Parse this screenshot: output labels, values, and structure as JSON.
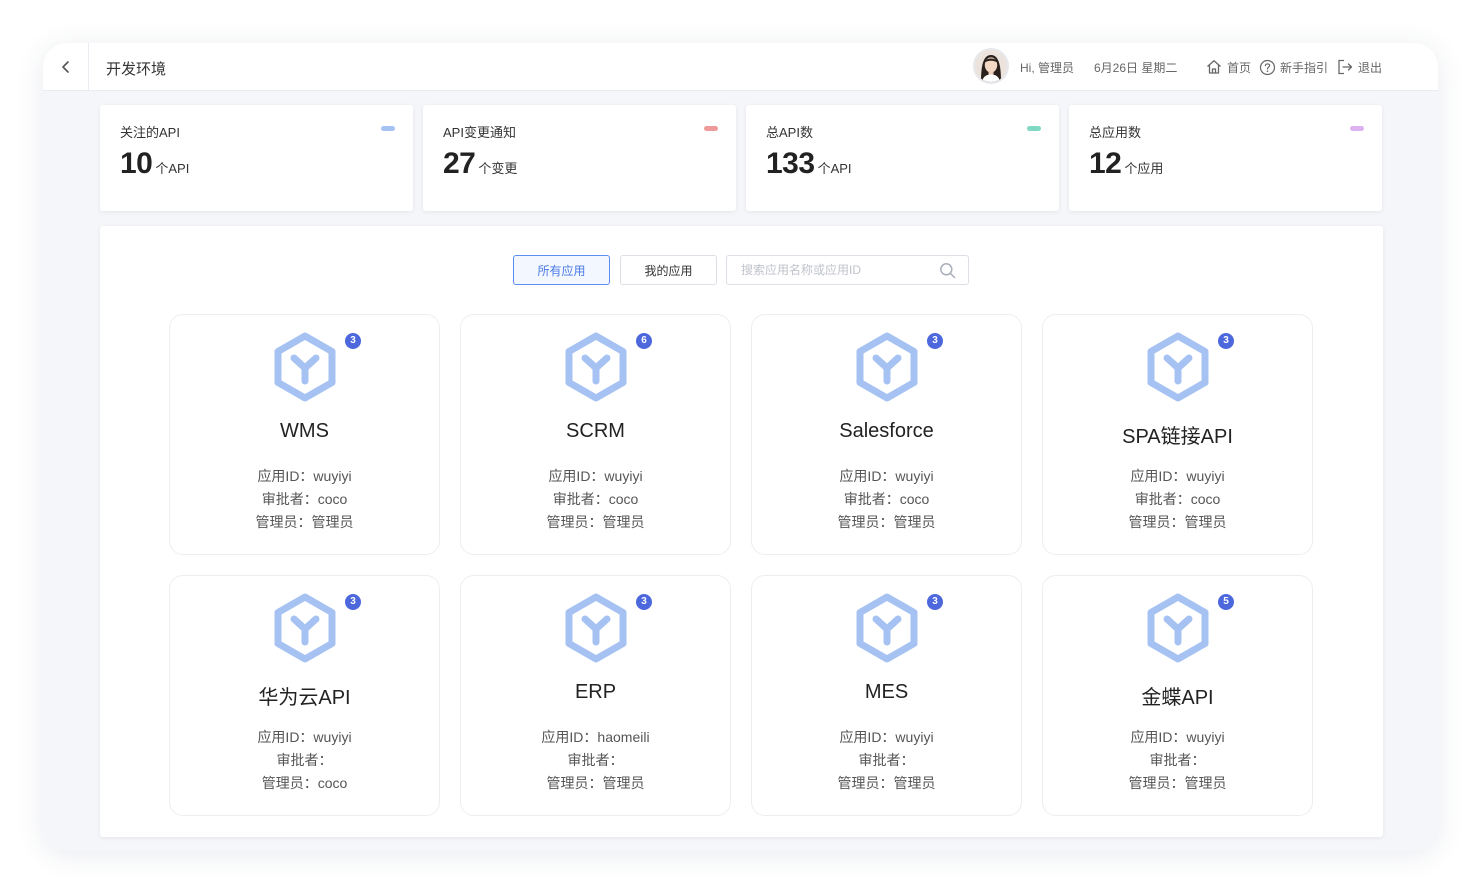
{
  "header": {
    "back_icon": "chevron-left-icon",
    "title": "开发环境",
    "greeting": "Hi, 管理员",
    "date": "6月26日 星期二",
    "nav": [
      {
        "label": "首页",
        "icon": "home-icon"
      },
      {
        "label": "新手指引",
        "icon": "help-circle-icon"
      },
      {
        "label": "退出",
        "icon": "logout-icon"
      }
    ]
  },
  "stats": [
    {
      "label": "关注的API",
      "value": "10",
      "unit": "个API",
      "color": "#a5c2f3"
    },
    {
      "label": "API变更通知",
      "value": "27",
      "unit": "个变更",
      "color": "#ef9a9a"
    },
    {
      "label": "总API数",
      "value": "133",
      "unit": "个API",
      "color": "#7fd8c1"
    },
    {
      "label": "总应用数",
      "value": "12",
      "unit": "个应用",
      "color": "#dcb2f0"
    }
  ],
  "filters": {
    "all_label": "所有应用",
    "mine_label": "我的应用",
    "search_placeholder": "搜索应用名称或应用ID",
    "search_value": ""
  },
  "colors": {
    "app_icon": "#a5c2f3",
    "badge": "#4d68dd",
    "accent": "#5b8ef0"
  },
  "apps": [
    {
      "name": "WMS",
      "badge": "3",
      "id_line": "应用ID：wuyiyi",
      "approver_line": "审批者：coco",
      "admin_line": "管理员：管理员"
    },
    {
      "name": "SCRM",
      "badge": "6",
      "id_line": "应用ID：wuyiyi",
      "approver_line": "审批者：coco",
      "admin_line": "管理员：管理员"
    },
    {
      "name": "Salesforce",
      "badge": "3",
      "id_line": "应用ID：wuyiyi",
      "approver_line": "审批者：coco",
      "admin_line": "管理员：管理员"
    },
    {
      "name": "SPA链接API",
      "badge": "3",
      "id_line": "应用ID：wuyiyi",
      "approver_line": "审批者：coco",
      "admin_line": "管理员：管理员"
    },
    {
      "name": "华为云API",
      "badge": "3",
      "id_line": "应用ID：wuyiyi",
      "approver_line": "审批者：",
      "admin_line": "管理员：coco"
    },
    {
      "name": "ERP",
      "badge": "3",
      "id_line": "应用ID：haomeili",
      "approver_line": "审批者：",
      "admin_line": "管理员：管理员"
    },
    {
      "name": "MES",
      "badge": "3",
      "id_line": "应用ID：wuyiyi",
      "approver_line": "审批者：",
      "admin_line": "管理员：管理员"
    },
    {
      "name": "金蝶API",
      "badge": "5",
      "id_line": "应用ID：wuyiyi",
      "approver_line": "审批者：",
      "admin_line": "管理员：管理员"
    }
  ]
}
